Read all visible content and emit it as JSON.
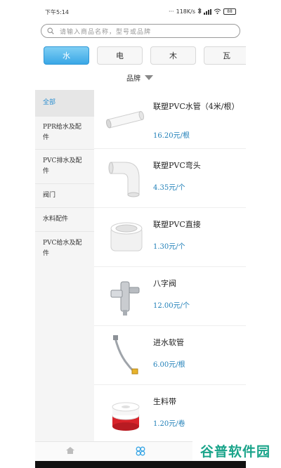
{
  "status_bar": {
    "time": "下午5:14",
    "network_speed": "118K/s",
    "battery": "88"
  },
  "search": {
    "placeholder": "请输入商品名称，型号或品牌"
  },
  "categories": [
    {
      "label": "水",
      "active": true
    },
    {
      "label": "电",
      "active": false
    },
    {
      "label": "木",
      "active": false
    },
    {
      "label": "瓦",
      "active": false
    }
  ],
  "brand_filter": {
    "label": "品牌"
  },
  "sidebar": {
    "items": [
      {
        "label": "全部",
        "active": true
      },
      {
        "label": "PPR给水及配件",
        "active": false
      },
      {
        "label": "PVC排水及配件",
        "active": false
      },
      {
        "label": "阀门",
        "active": false
      },
      {
        "label": "水料配件",
        "active": false
      },
      {
        "label": "PVC给水及配件",
        "active": false
      }
    ]
  },
  "products": [
    {
      "name": "联塑PVC水管（4米/根）",
      "price": "16.20元/根",
      "icon": "pvc-pipe"
    },
    {
      "name": "联塑PVC弯头",
      "price": "4.35元/个",
      "icon": "pvc-elbow"
    },
    {
      "name": "联塑PVC直接",
      "price": "1.30元/个",
      "icon": "pvc-coupling"
    },
    {
      "name": "八字阀",
      "price": "12.00元/个",
      "icon": "angle-valve"
    },
    {
      "name": "进水软管",
      "price": "6.00元/根",
      "icon": "inlet-hose"
    },
    {
      "name": "生料带",
      "price": "1.20元/卷",
      "icon": "ptfe-tape"
    }
  ],
  "tab_bar": {
    "tabs": [
      {
        "icon": "home-icon"
      },
      {
        "icon": "category-icon"
      }
    ]
  },
  "watermark": "谷普软件园",
  "colors": {
    "accent": "#3aa7e6",
    "price": "#1f7fb8",
    "sidebar_active": "#2c8fd0",
    "watermark": "#1aa48a"
  }
}
